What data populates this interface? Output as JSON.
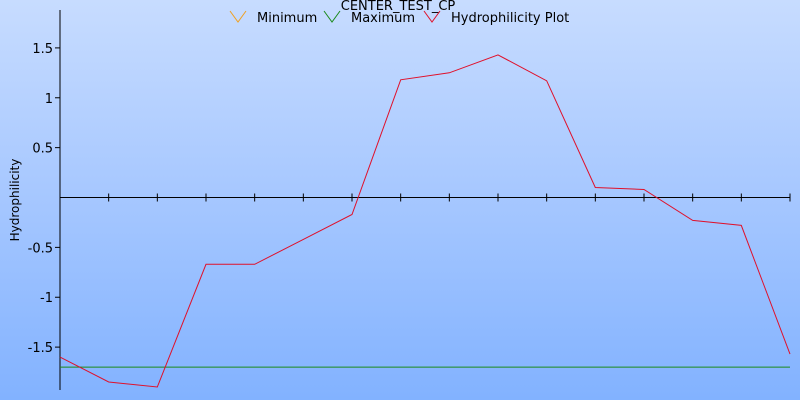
{
  "chart_data": {
    "type": "line",
    "title": "CENTER_TEST_CP",
    "ylabel": "Hydrophilicity",
    "xlabel": "",
    "ylim": [
      -1.93,
      1.88
    ],
    "xlim": [
      0,
      15
    ],
    "y_ticks": [
      {
        "value": 1.5,
        "label": "1.5"
      },
      {
        "value": 1,
        "label": "1"
      },
      {
        "value": 0.5,
        "label": "0.5"
      },
      {
        "value": -0.5,
        "label": "-0.5"
      },
      {
        "value": -1,
        "label": "-1"
      },
      {
        "value": -1.5,
        "label": "-1.5"
      }
    ],
    "x_ticks": [
      1,
      2,
      3,
      4,
      5,
      6,
      7,
      8,
      9,
      10,
      11,
      12,
      13,
      14,
      15
    ],
    "grid": false,
    "legend_position": "top",
    "legend": [
      {
        "label": "Minimum",
        "color": "#f0a020"
      },
      {
        "label": "Maximum",
        "color": "#1a8a1a"
      },
      {
        "label": "Hydrophilicity Plot",
        "color": "#e0102a"
      }
    ],
    "series": [
      {
        "name": "Minimum",
        "color": "#f0a020",
        "x": [],
        "y": []
      },
      {
        "name": "Maximum",
        "color": "#1a8a1a",
        "x": [
          0,
          15
        ],
        "y": [
          -1.7,
          -1.7
        ]
      },
      {
        "name": "Hydrophilicity Plot",
        "color": "#e0102a",
        "x": [
          0,
          1,
          2,
          3,
          4,
          5,
          6,
          7,
          8,
          9,
          10,
          11,
          12,
          13,
          14,
          15
        ],
        "y": [
          -1.6,
          -1.85,
          -1.9,
          -0.67,
          -0.67,
          -0.42,
          -0.17,
          1.18,
          1.25,
          1.43,
          1.17,
          0.1,
          0.08,
          -0.23,
          -0.28,
          -1.57
        ]
      }
    ]
  }
}
